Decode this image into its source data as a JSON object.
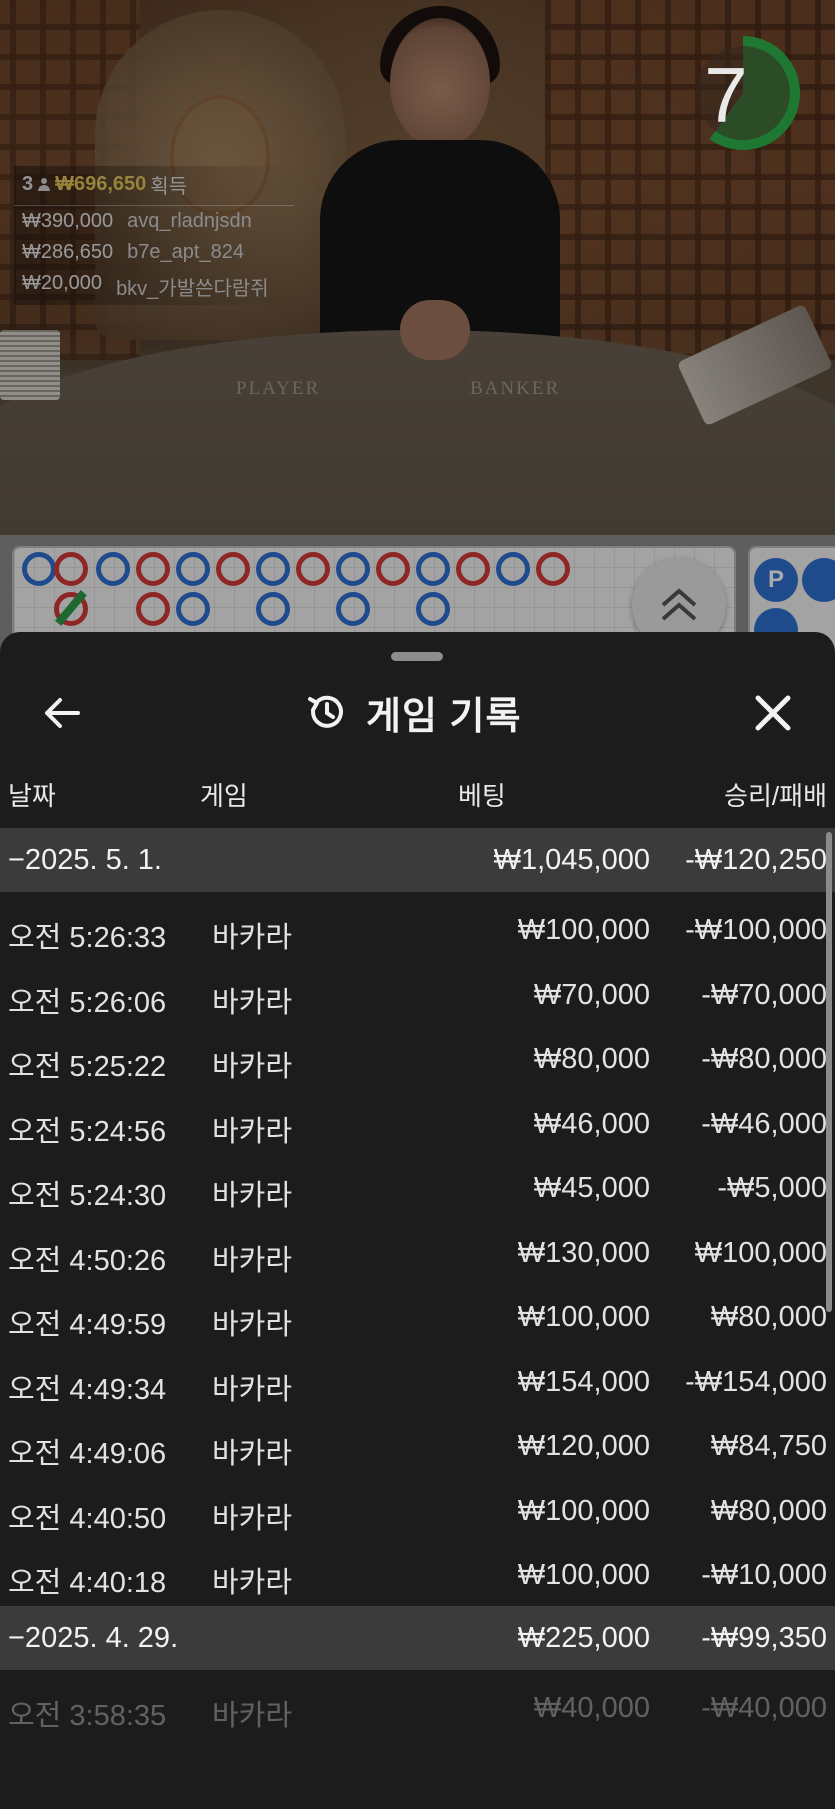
{
  "timer": {
    "value": "7",
    "progress": 0.6
  },
  "winners": {
    "count": "3",
    "total": "₩696,650",
    "suffix": "획득",
    "list": [
      {
        "amount": "₩390,000",
        "user": "avq_rladnjsdn"
      },
      {
        "amount": "₩286,650",
        "user": "b7e_apt_824"
      },
      {
        "amount": "₩20,000",
        "user": "bkv_가발쓴다람쥐"
      }
    ]
  },
  "table_labels": {
    "player": "PLAYER",
    "banker": "BANKER"
  },
  "roadmap": {
    "side_bead_label": "P"
  },
  "sheet": {
    "title": "게임 기록",
    "icons": {
      "back": "back-arrow-icon",
      "history": "history-icon",
      "close": "close-icon"
    },
    "columns": {
      "date": "날짜",
      "game": "게임",
      "bet": "베팅",
      "result": "승리/패배"
    },
    "groups": [
      {
        "date": "−2025. 5. 1.",
        "bet": "₩1,045,000",
        "result": "-₩120,250",
        "rows": [
          {
            "time": "오전 5:26:33",
            "game": "바카라",
            "bet": "₩100,000",
            "result": "-₩100,000"
          },
          {
            "time": "오전 5:26:06",
            "game": "바카라",
            "bet": "₩70,000",
            "result": "-₩70,000"
          },
          {
            "time": "오전 5:25:22",
            "game": "바카라",
            "bet": "₩80,000",
            "result": "-₩80,000"
          },
          {
            "time": "오전 5:24:56",
            "game": "바카라",
            "bet": "₩46,000",
            "result": "-₩46,000"
          },
          {
            "time": "오전 5:24:30",
            "game": "바카라",
            "bet": "₩45,000",
            "result": "-₩5,000"
          },
          {
            "time": "오전 4:50:26",
            "game": "바카라",
            "bet": "₩130,000",
            "result": "₩100,000"
          },
          {
            "time": "오전 4:49:59",
            "game": "바카라",
            "bet": "₩100,000",
            "result": "₩80,000"
          },
          {
            "time": "오전 4:49:34",
            "game": "바카라",
            "bet": "₩154,000",
            "result": "-₩154,000"
          },
          {
            "time": "오전 4:49:06",
            "game": "바카라",
            "bet": "₩120,000",
            "result": "₩84,750"
          },
          {
            "time": "오전 4:40:50",
            "game": "바카라",
            "bet": "₩100,000",
            "result": "₩80,000"
          },
          {
            "time": "오전 4:40:18",
            "game": "바카라",
            "bet": "₩100,000",
            "result": "-₩10,000"
          }
        ]
      },
      {
        "date": "−2025. 4. 29.",
        "bet": "₩225,000",
        "result": "-₩99,350",
        "rows": [
          {
            "time": "오전 3:58:35",
            "game": "바카라",
            "bet": "₩40,000",
            "result": "-₩40,000"
          }
        ]
      }
    ]
  }
}
